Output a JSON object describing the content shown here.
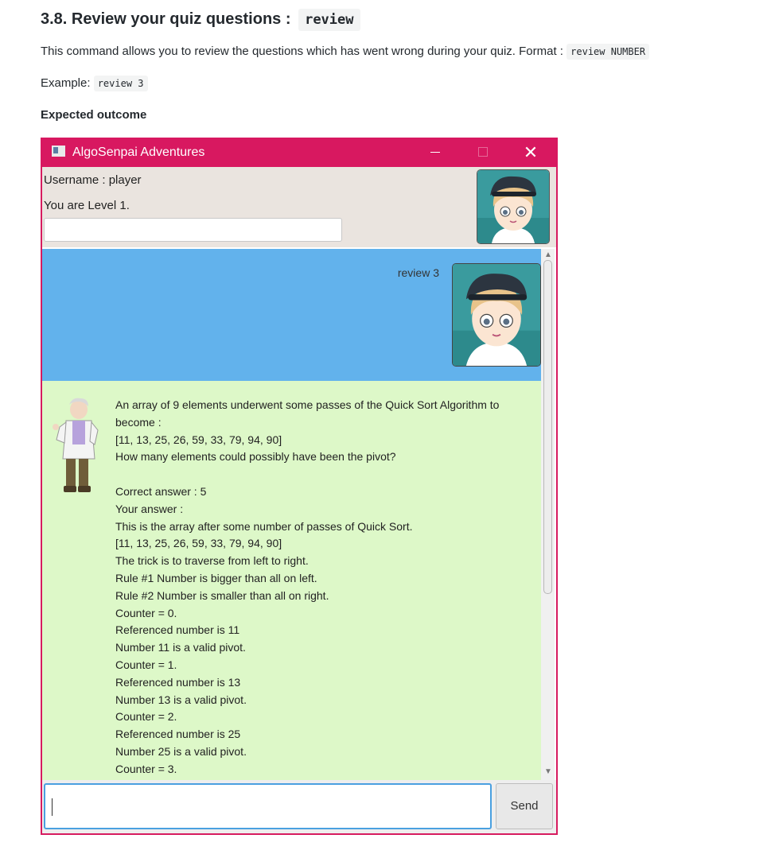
{
  "doc": {
    "heading_text": "3.8. Review your quiz questions :",
    "heading_code": "review",
    "description": "This command allows you to review the questions which has went wrong during your quiz. Format :",
    "format_code": "review NUMBER",
    "example_label": "Example:",
    "example_code": "review 3",
    "outcome_label": "Expected outcome"
  },
  "window": {
    "title": "AlgoSenpai Adventures",
    "close_symbol": "✕",
    "titlebar_color": "#d81860"
  },
  "user_panel": {
    "username": "Username : player",
    "level": "You are Level 1."
  },
  "chat": {
    "user_message": "review 3",
    "user_bubble_color": "#62b2ec",
    "bot_bubble_color": "#ddf8c8",
    "bot_lines": [
      "An array of 9 elements underwent some passes of the Quick Sort Algorithm to",
      "become :",
      "[11, 13, 25, 26, 59, 33, 79, 94, 90]",
      "How many elements could possibly have been the pivot?",
      "",
      "Correct answer : 5",
      "Your answer :",
      "This is the array after some number of passes of Quick Sort.",
      "[11, 13, 25, 26, 59, 33, 79, 94, 90]",
      "The trick is to traverse from left to right.",
      "Rule #1 Number is bigger than all on left.",
      "Rule #2 Number is smaller than all on right.",
      "Counter = 0.",
      "Referenced number is 11",
      "Number 11 is a valid pivot.",
      "Counter = 1.",
      "Referenced number is 13",
      "Number 13 is a valid pivot.",
      "Counter = 2.",
      "Referenced number is 25",
      "Number 25 is a valid pivot.",
      "Counter = 3."
    ]
  },
  "input": {
    "value": "",
    "send_label": "Send"
  },
  "icons": {
    "app": "app-window-icon",
    "player_avatar": "player-avatar-icon",
    "professor_avatar": "professor-avatar-icon"
  }
}
